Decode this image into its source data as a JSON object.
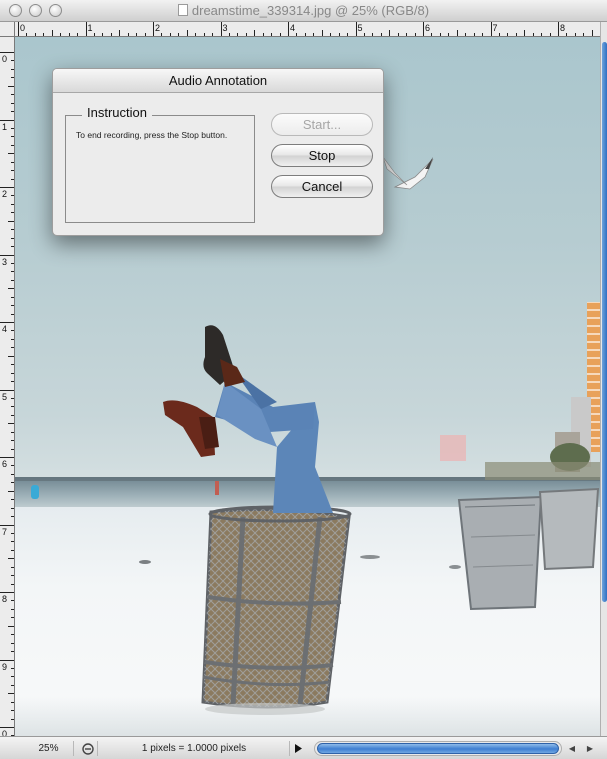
{
  "window": {
    "title": "dreamstime_339314.jpg @ 25% (RGB/8)"
  },
  "rulers": {
    "horizontal_labels": [
      "0",
      "1",
      "2",
      "3",
      "4",
      "5",
      "6",
      "7",
      "8"
    ],
    "vertical_labels": [
      "0",
      "1",
      "2",
      "3",
      "4",
      "5",
      "6",
      "7",
      "8",
      "9",
      "0"
    ]
  },
  "dialog": {
    "title": "Audio Annotation",
    "group_label": "Instruction",
    "instruction_text": "To end recording, press the Stop button.",
    "buttons": {
      "start": "Start...",
      "stop": "Stop",
      "cancel": "Cancel"
    },
    "start_enabled": false
  },
  "statusbar": {
    "zoom": "25%",
    "doc_info": "1 pixels = 1.0000 pixels",
    "menu_icon": "triangle-right-icon",
    "left_arrow": "◀",
    "right_arrow": "▶"
  },
  "colors": {
    "accent": "#3f7fd1",
    "sky": "#b6ccd1"
  }
}
